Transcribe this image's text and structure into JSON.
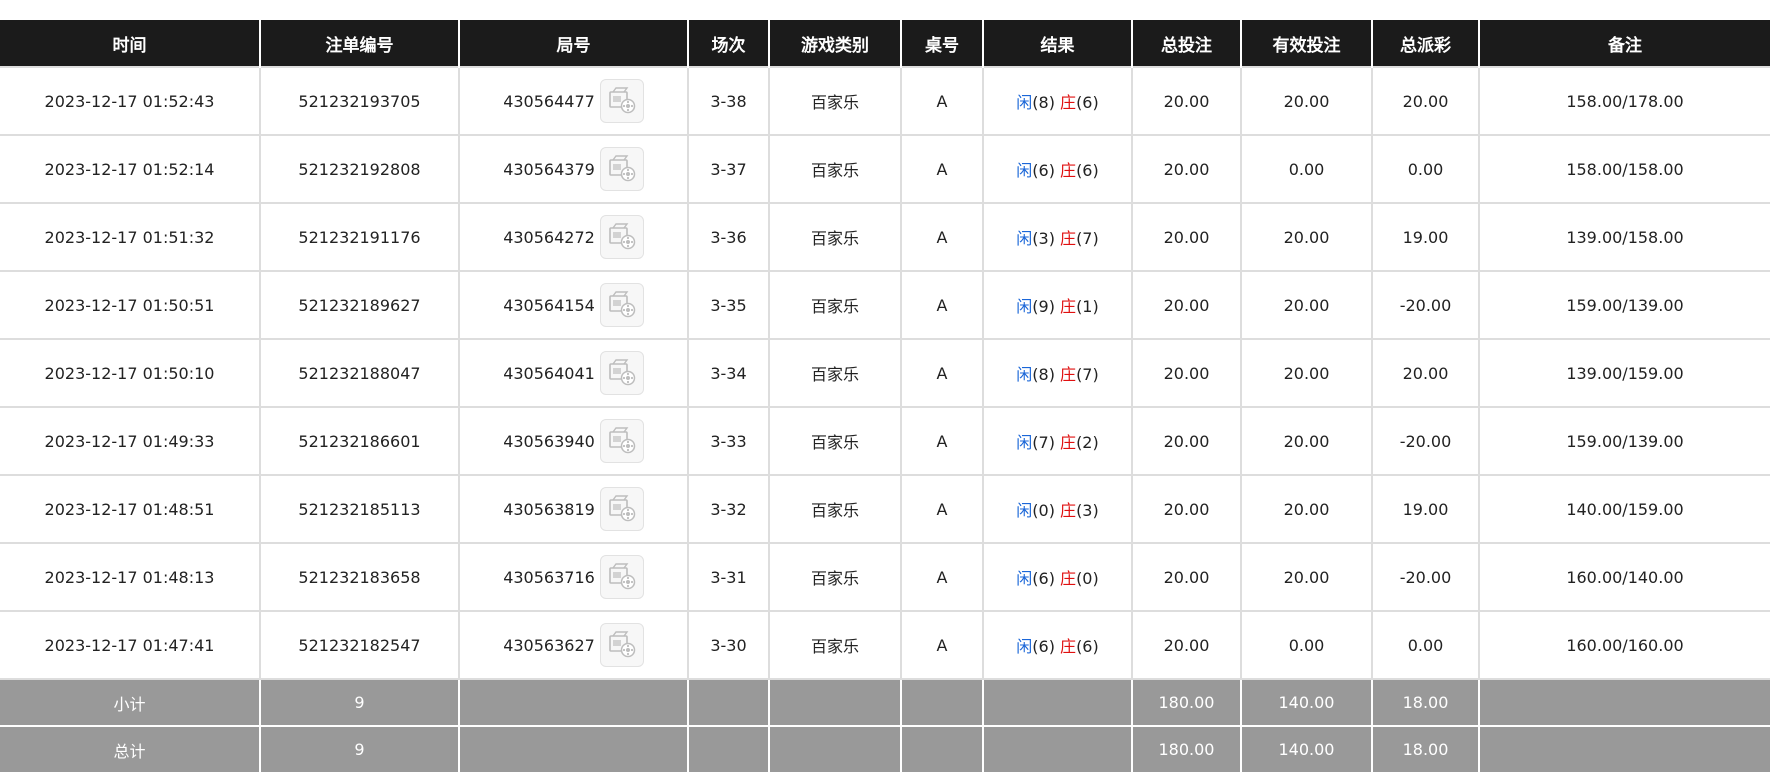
{
  "headers": [
    "时间",
    "注单编号",
    "局号",
    "场次",
    "游戏类别",
    "桌号",
    "结果",
    "总投注",
    "有效投注",
    "总派彩",
    "备注"
  ],
  "labels": {
    "player": "闲",
    "banker": "庄"
  },
  "icons": {
    "replay": "video-replay-icon"
  },
  "colors": {
    "header_bg": "#1b1b1b",
    "bet_blue": "#1a66d8",
    "negative_red": "#e01010",
    "banker_red": "#e01010",
    "player_blue": "#1a66d8",
    "total_bg": "#999999"
  },
  "rows": [
    {
      "time": "2023-12-17 01:52:43",
      "bet_id": "521232193705",
      "round_id": "430564477",
      "shoe": "3-38",
      "game": "百家乐",
      "table": "A",
      "player_score": "(8)",
      "banker_score": "(6)",
      "total_bet": "20.00",
      "valid_bet": "20.00",
      "payout": "20.00",
      "payout_negative": false,
      "note": "158.00/178.00"
    },
    {
      "time": "2023-12-17 01:52:14",
      "bet_id": "521232192808",
      "round_id": "430564379",
      "shoe": "3-37",
      "game": "百家乐",
      "table": "A",
      "player_score": "(6)",
      "banker_score": "(6)",
      "total_bet": "20.00",
      "valid_bet": "0.00",
      "payout": "0.00",
      "payout_negative": false,
      "note": "158.00/158.00"
    },
    {
      "time": "2023-12-17 01:51:32",
      "bet_id": "521232191176",
      "round_id": "430564272",
      "shoe": "3-36",
      "game": "百家乐",
      "table": "A",
      "player_score": "(3)",
      "banker_score": "(7)",
      "total_bet": "20.00",
      "valid_bet": "20.00",
      "payout": "19.00",
      "payout_negative": false,
      "note": "139.00/158.00"
    },
    {
      "time": "2023-12-17 01:50:51",
      "bet_id": "521232189627",
      "round_id": "430564154",
      "shoe": "3-35",
      "game": "百家乐",
      "table": "A",
      "player_score": "(9)",
      "banker_score": "(1)",
      "total_bet": "20.00",
      "valid_bet": "20.00",
      "payout": "-20.00",
      "payout_negative": true,
      "note": "159.00/139.00"
    },
    {
      "time": "2023-12-17 01:50:10",
      "bet_id": "521232188047",
      "round_id": "430564041",
      "shoe": "3-34",
      "game": "百家乐",
      "table": "A",
      "player_score": "(8)",
      "banker_score": "(7)",
      "total_bet": "20.00",
      "valid_bet": "20.00",
      "payout": "20.00",
      "payout_negative": false,
      "note": "139.00/159.00"
    },
    {
      "time": "2023-12-17 01:49:33",
      "bet_id": "521232186601",
      "round_id": "430563940",
      "shoe": "3-33",
      "game": "百家乐",
      "table": "A",
      "player_score": "(7)",
      "banker_score": "(2)",
      "total_bet": "20.00",
      "valid_bet": "20.00",
      "payout": "-20.00",
      "payout_negative": true,
      "note": "159.00/139.00"
    },
    {
      "time": "2023-12-17 01:48:51",
      "bet_id": "521232185113",
      "round_id": "430563819",
      "shoe": "3-32",
      "game": "百家乐",
      "table": "A",
      "player_score": "(0)",
      "banker_score": "(3)",
      "total_bet": "20.00",
      "valid_bet": "20.00",
      "payout": "19.00",
      "payout_negative": false,
      "note": "140.00/159.00"
    },
    {
      "time": "2023-12-17 01:48:13",
      "bet_id": "521232183658",
      "round_id": "430563716",
      "shoe": "3-31",
      "game": "百家乐",
      "table": "A",
      "player_score": "(6)",
      "banker_score": "(0)",
      "total_bet": "20.00",
      "valid_bet": "20.00",
      "payout": "-20.00",
      "payout_negative": true,
      "note": "160.00/140.00"
    },
    {
      "time": "2023-12-17 01:47:41",
      "bet_id": "521232182547",
      "round_id": "430563627",
      "shoe": "3-30",
      "game": "百家乐",
      "table": "A",
      "player_score": "(6)",
      "banker_score": "(6)",
      "total_bet": "20.00",
      "valid_bet": "0.00",
      "payout": "0.00",
      "payout_negative": false,
      "note": "160.00/160.00"
    }
  ],
  "subtotal": {
    "label": "小计",
    "count": "9",
    "total_bet": "180.00",
    "valid_bet": "140.00",
    "payout": "18.00"
  },
  "total": {
    "label": "总计",
    "count": "9",
    "total_bet": "180.00",
    "valid_bet": "140.00",
    "payout": "18.00"
  }
}
